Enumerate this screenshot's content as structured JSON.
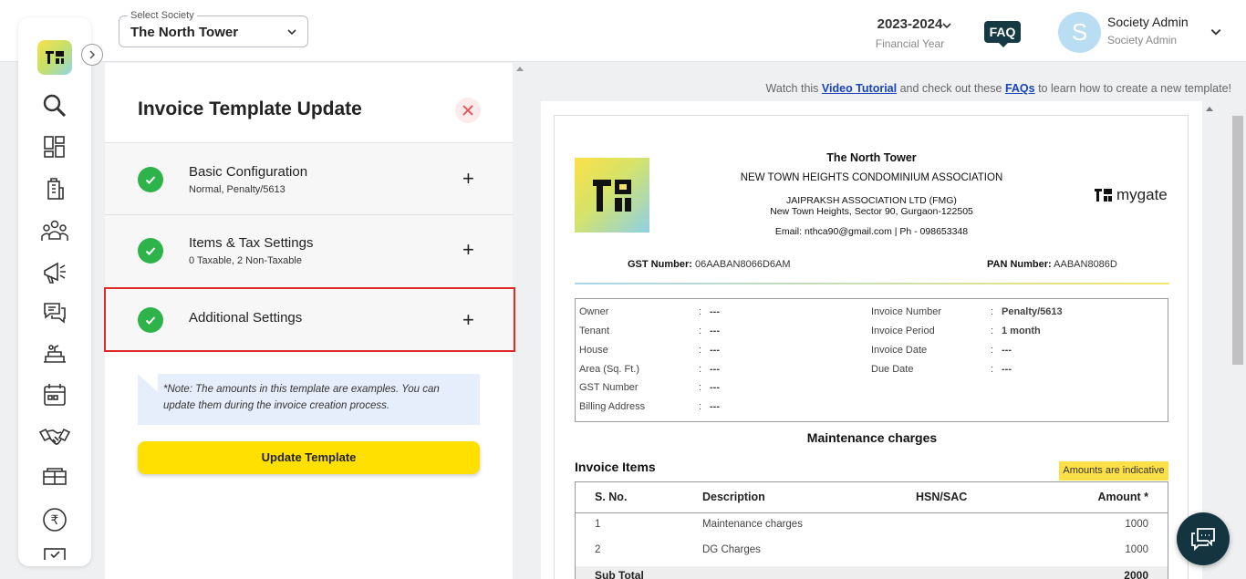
{
  "header": {
    "society_select_label": "Select Society",
    "society_select_value": "The North Tower",
    "financial_year": "2023-2024",
    "financial_year_label": "Financial Year",
    "faq_label": "FAQ",
    "avatar_initial": "S",
    "user_name": "Society Admin",
    "user_role": "Society Admin"
  },
  "sidebar": {
    "items": [
      "search-icon",
      "dashboard-icon",
      "building-icon",
      "residents-icon",
      "notice-icon",
      "chat-icon",
      "facility-icon",
      "calendar-icon",
      "handshake-icon",
      "amenities-icon",
      "accounts-rupee-icon",
      "tasks-icon"
    ]
  },
  "panel": {
    "title": "Invoice Template Update",
    "sections": [
      {
        "title": "Basic Configuration",
        "subtitle": "Normal, Penalty/5613"
      },
      {
        "title": "Items & Tax Settings",
        "subtitle": "0 Taxable, 2 Non-Taxable"
      },
      {
        "title": "Additional Settings",
        "subtitle": ""
      }
    ],
    "note": "*Note: The amounts in this template are examples. You can update them during the invoice creation process.",
    "update_button": "Update Template"
  },
  "tutorial": {
    "prefix": "Watch this ",
    "video_link": "Video Tutorial",
    "middle": " and check out these ",
    "faq_link": "FAQs",
    "suffix": " to learn how to create a new template!"
  },
  "invoice": {
    "society_name": "The North Tower",
    "association": "NEW TOWN HEIGHTS CONDOMINIUM ASSOCIATION",
    "builder": "JAIPRAKSH ASSOCIATION LTD (FMG)",
    "address": "New Town Heights, Sector 90, Gurgaon-122505",
    "contact": "Email: nthca90@gmail.com | Ph - 098653348",
    "brand": "mygate",
    "gst_label": "GST Number:",
    "gst_value": "06AABAN8066D6AM",
    "pan_label": "PAN Number:",
    "pan_value": "AABAN8086D",
    "left_details": [
      {
        "label": "Owner",
        "value": "---"
      },
      {
        "label": "Tenant",
        "value": "---"
      },
      {
        "label": "House",
        "value": "---"
      },
      {
        "label": "Area (Sq. Ft.)",
        "value": "---"
      },
      {
        "label": "GST Number",
        "value": "---"
      },
      {
        "label": "Billing Address",
        "value": "---"
      }
    ],
    "right_details": [
      {
        "label": "Invoice Number",
        "value": "Penalty/5613"
      },
      {
        "label": "Invoice Period",
        "value": "1 month"
      },
      {
        "label": "Invoice Date",
        "value": "---"
      },
      {
        "label": "Due Date",
        "value": "---"
      }
    ],
    "charges_title": "Maintenance charges",
    "items_title": "Invoice Items",
    "indicative_badge": "Amounts are indicative",
    "columns": [
      "S. No.",
      "Description",
      "HSN/SAC",
      "Amount *"
    ],
    "rows": [
      {
        "sno": "1",
        "description": "Maintenance charges",
        "hsn": "",
        "amount": "1000"
      },
      {
        "sno": "2",
        "description": "DG Charges",
        "hsn": "",
        "amount": "1000"
      }
    ],
    "subtotal_label": "Sub Total",
    "subtotal_value": "2000"
  },
  "colors": {
    "accent_yellow": "#ffe000",
    "success_green": "#2eb34a",
    "highlight_red": "#e02a2a",
    "dark_teal": "#163a44"
  }
}
